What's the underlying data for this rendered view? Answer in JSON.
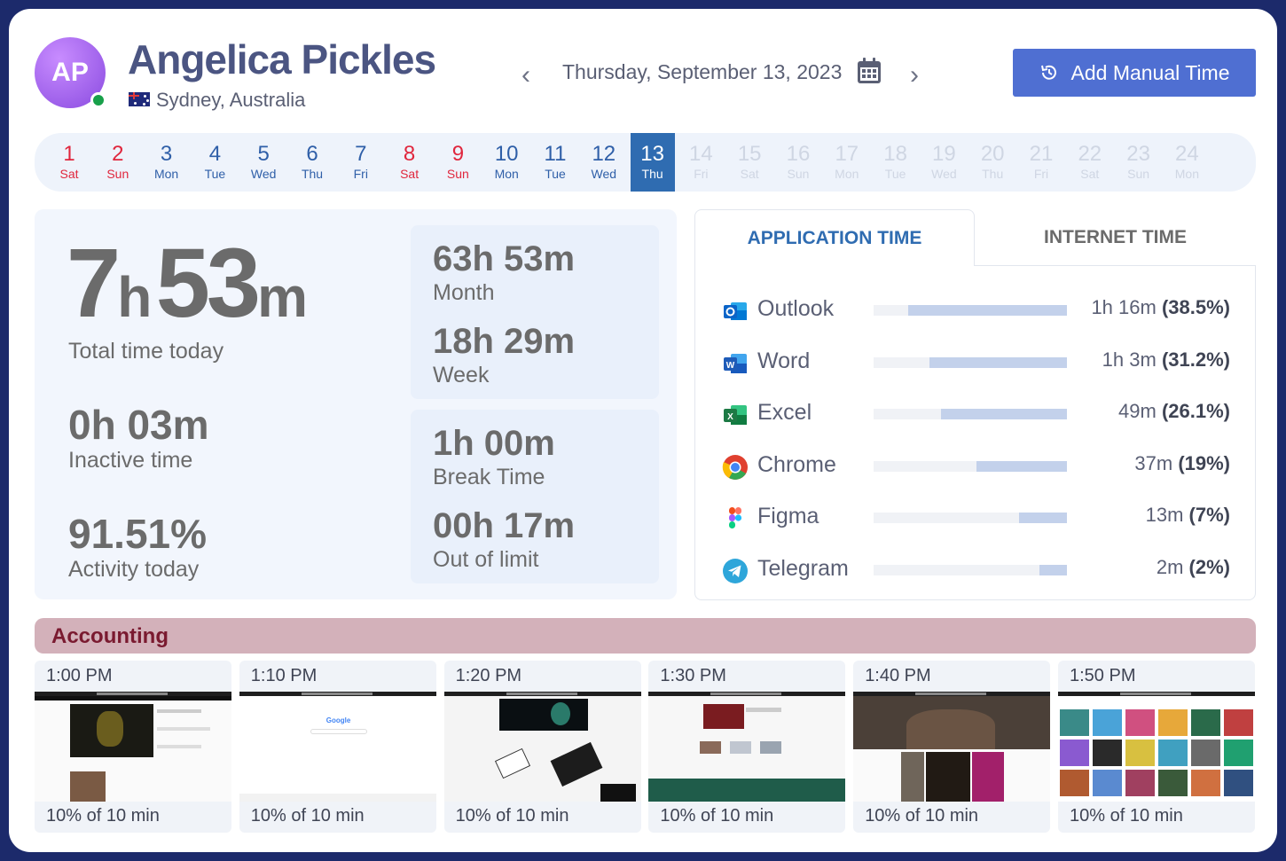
{
  "user": {
    "initials": "AP",
    "name": "Angelica Pickles",
    "location": "Sydney, Australia",
    "status": "online"
  },
  "date_nav": {
    "current_date": "Thursday, September 13, 2023",
    "prev_icon": "chevron-left-icon",
    "next_icon": "chevron-right-icon",
    "calendar_icon": "calendar-icon"
  },
  "add_manual_time": {
    "label": "Add Manual Time",
    "icon": "history-icon"
  },
  "days": [
    {
      "num": "1",
      "wd": "Sat",
      "kind": "weekend"
    },
    {
      "num": "2",
      "wd": "Sun",
      "kind": "weekend"
    },
    {
      "num": "3",
      "wd": "Mon",
      "kind": "weekday"
    },
    {
      "num": "4",
      "wd": "Tue",
      "kind": "weekday"
    },
    {
      "num": "5",
      "wd": "Wed",
      "kind": "weekday"
    },
    {
      "num": "6",
      "wd": "Thu",
      "kind": "weekday"
    },
    {
      "num": "7",
      "wd": "Fri",
      "kind": "weekday"
    },
    {
      "num": "8",
      "wd": "Sat",
      "kind": "weekend"
    },
    {
      "num": "9",
      "wd": "Sun",
      "kind": "weekend"
    },
    {
      "num": "10",
      "wd": "Mon",
      "kind": "weekday"
    },
    {
      "num": "11",
      "wd": "Tue",
      "kind": "weekday"
    },
    {
      "num": "12",
      "wd": "Wed",
      "kind": "weekday"
    },
    {
      "num": "13",
      "wd": "Thu",
      "kind": "selected"
    },
    {
      "num": "14",
      "wd": "Fri",
      "kind": "future"
    },
    {
      "num": "15",
      "wd": "Sat",
      "kind": "future"
    },
    {
      "num": "16",
      "wd": "Sun",
      "kind": "future"
    },
    {
      "num": "17",
      "wd": "Mon",
      "kind": "future"
    },
    {
      "num": "18",
      "wd": "Tue",
      "kind": "future"
    },
    {
      "num": "19",
      "wd": "Wed",
      "kind": "future"
    },
    {
      "num": "20",
      "wd": "Thu",
      "kind": "future"
    },
    {
      "num": "21",
      "wd": "Fri",
      "kind": "future"
    },
    {
      "num": "22",
      "wd": "Sat",
      "kind": "future"
    },
    {
      "num": "23",
      "wd": "Sun",
      "kind": "future"
    },
    {
      "num": "24",
      "wd": "Mon",
      "kind": "future"
    }
  ],
  "stats": {
    "total_hours": "7",
    "total_h_unit": "h",
    "total_minutes": "53",
    "total_m_unit": "m",
    "total_label": "Total time today",
    "inactive_value": "0h 03m",
    "inactive_label": "Inactive time",
    "activity_value": "91.51%",
    "activity_label": "Activity today",
    "month_value": "63h 53m",
    "month_label": "Month",
    "week_value": "18h 29m",
    "week_label": "Week",
    "break_value": "1h 00m",
    "break_label": "Break Time",
    "limit_value": "00h 17m",
    "limit_label": "Out of limit"
  },
  "tabs": {
    "application": "APPLICATION TIME",
    "internet": "INTERNET TIME"
  },
  "apps": [
    {
      "name": "Outlook",
      "time": "1h 16m",
      "pct": "(38.5%)",
      "share": 0.82,
      "icon": "outlook-icon",
      "color": "#0a64c8"
    },
    {
      "name": "Word",
      "time": "1h 3m",
      "pct": "(31.2%)",
      "share": 0.71,
      "icon": "word-icon",
      "color": "#1e5bb8"
    },
    {
      "name": "Excel",
      "time": "49m",
      "pct": "(26.1%)",
      "share": 0.65,
      "icon": "excel-icon",
      "color": "#1d7a45"
    },
    {
      "name": "Chrome",
      "time": "37m",
      "pct": "(19%)",
      "share": 0.47,
      "icon": "chrome-icon",
      "color": "#e0402f"
    },
    {
      "name": "Figma",
      "time": "13m",
      "pct": "(7%)",
      "share": 0.25,
      "icon": "figma-icon",
      "color": "#a259ff"
    },
    {
      "name": "Telegram",
      "time": "2m",
      "pct": "(2%)",
      "share": 0.14,
      "icon": "telegram-icon",
      "color": "#2ea6da"
    }
  ],
  "accounting": {
    "title": "Accounting",
    "screenshots": [
      {
        "time": "1:00 PM",
        "caption": "10% of 10 min"
      },
      {
        "time": "1:10 PM",
        "caption": "10% of 10 min"
      },
      {
        "time": "1:20 PM",
        "caption": "10% of 10 min"
      },
      {
        "time": "1:30 PM",
        "caption": "10% of 10 min"
      },
      {
        "time": "1:40 PM",
        "caption": "10% of 10 min"
      },
      {
        "time": "1:50 PM",
        "caption": "10% of 10 min"
      }
    ]
  },
  "colors": {
    "accent": "#2f6cb1",
    "button": "#4f6fd2",
    "weekend": "#e0263d",
    "accounting_bg": "#d3b1ba",
    "accounting_text": "#7a1a30"
  }
}
